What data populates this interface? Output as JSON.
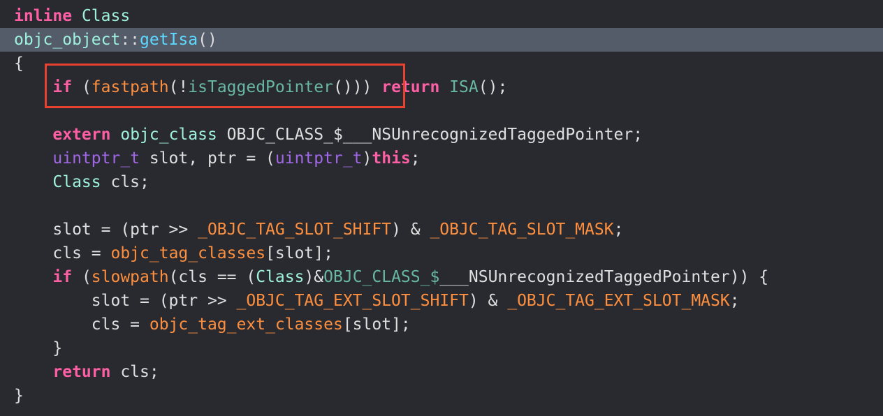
{
  "code": {
    "l1": {
      "a": "inline",
      "b": " ",
      "c": "Class"
    },
    "l2": {
      "a": "objc_object",
      "b": "::",
      "c": "getIsa",
      "d": "()"
    },
    "l3": {
      "a": "{"
    },
    "l4": {
      "i": "    ",
      "a": "if",
      "b": " (",
      "c": "fastpath",
      "d": "(!",
      "e": "isTaggedPointer",
      "f": "())) ",
      "g": "return",
      "h": " ",
      "j": "ISA",
      "k": "();"
    },
    "l6": {
      "i": "    ",
      "a": "extern",
      "b": " ",
      "c": "objc_class",
      "d": " OBJC_CLASS_$___NSUnrecognizedTaggedPointer;"
    },
    "l7": {
      "i": "    ",
      "a": "uintptr_t",
      "b": " slot, ptr = (",
      "c": "uintptr_t",
      "d": ")",
      "e": "this",
      "f": ";"
    },
    "l8": {
      "i": "    ",
      "a": "Class",
      "b": " cls;"
    },
    "l10": {
      "i": "    ",
      "a": "slot = (ptr >> ",
      "b": "_OBJC_TAG_SLOT_SHIFT",
      "c": ") & ",
      "d": "_OBJC_TAG_SLOT_MASK",
      "e": ";"
    },
    "l11": {
      "i": "    ",
      "a": "cls = ",
      "b": "objc_tag_classes",
      "c": "[slot];"
    },
    "l12": {
      "i": "    ",
      "a": "if",
      "b": " (",
      "c": "slowpath",
      "d": "(cls == (",
      "e": "Class",
      "f": ")&",
      "g": "OBJC_CLASS_$",
      "h": "___NSUnrecognizedTaggedPointer",
      "j": ")) {"
    },
    "l13": {
      "i": "        ",
      "a": "slot = (ptr >> ",
      "b": "_OBJC_TAG_EXT_SLOT_SHIFT",
      "c": ") & ",
      "d": "_OBJC_TAG_EXT_SLOT_MASK",
      "e": ";"
    },
    "l14": {
      "i": "        ",
      "a": "cls = ",
      "b": "objc_tag_ext_classes",
      "c": "[slot];"
    },
    "l15": {
      "i": "    ",
      "a": "}"
    },
    "l16": {
      "i": "    ",
      "a": "return",
      "b": " cls;"
    },
    "l17": {
      "a": "}"
    }
  },
  "colors": {
    "background": "#292a30",
    "highlight_line": "#545c6a",
    "annotation_box": "#e8412f",
    "keyword": "#fc5fa3",
    "type": "#9ef1dd",
    "function": "#67b7a4",
    "macro": "#fd8f3f",
    "plain": "#dfdfe0"
  }
}
